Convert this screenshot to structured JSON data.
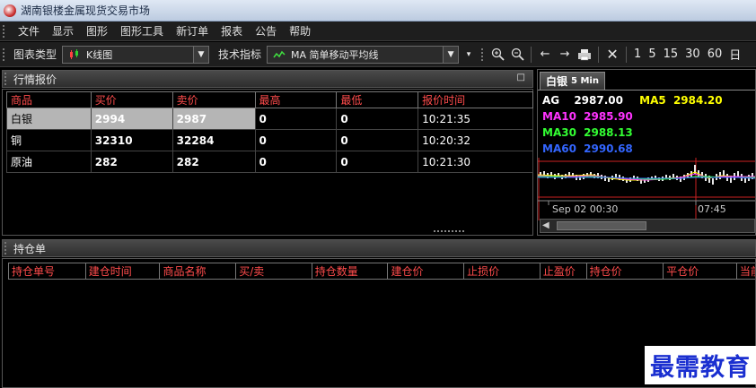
{
  "window": {
    "title": "湖南银楼金属现货交易市场"
  },
  "menu": [
    "文件",
    "显示",
    "图形",
    "图形工具",
    "新订单",
    "报表",
    "公告",
    "帮助"
  ],
  "toolbar": {
    "chart_type_label": "图表类型",
    "chart_type_value": "K线图",
    "indicator_label": "技术指标",
    "indicator_value": "MA  简单移动平均线",
    "periods": [
      "1",
      "5",
      "15",
      "30",
      "60",
      "日"
    ]
  },
  "quotes_panel": {
    "title": "行情报价",
    "columns": [
      "商品",
      "买价",
      "卖价",
      "最高",
      "最低",
      "报价时间"
    ],
    "rows": [
      {
        "name": "白银",
        "bid": "2994",
        "ask": "2987",
        "high": "0",
        "low": "0",
        "time": "10:21:35"
      },
      {
        "name": "铜",
        "bid": "32310",
        "ask": "32284",
        "high": "0",
        "low": "0",
        "time": "10:20:32"
      },
      {
        "name": "原油",
        "bid": "282",
        "ask": "282",
        "high": "0",
        "low": "0",
        "time": "10:21:30"
      }
    ]
  },
  "chart_panel": {
    "tab": "白银",
    "tab_period": "5 Min",
    "symbol": "AG",
    "price": "2987.00",
    "ma5_label": "MA5",
    "ma5": "2984.20",
    "ma10_label": "MA10",
    "ma10": "2985.90",
    "ma30_label": "MA30",
    "ma30": "2988.13",
    "ma60_label": "MA60",
    "ma60": "2990.68",
    "time_label_1": "Sep 02 00:30",
    "time_label_2": "07:45",
    "colors": {
      "ma5": "#ffff00",
      "ma10": "#ff33ff",
      "ma30": "#33ff33",
      "ma60": "#3366ff"
    }
  },
  "positions_panel": {
    "title": "持仓单",
    "columns": [
      "持仓单号",
      "建仓时间",
      "商品名称",
      "买/卖",
      "持仓数量",
      "建仓价",
      "止损价",
      "止盈价",
      "持仓价",
      "平仓价",
      "当前"
    ]
  },
  "watermark": "最需教育"
}
